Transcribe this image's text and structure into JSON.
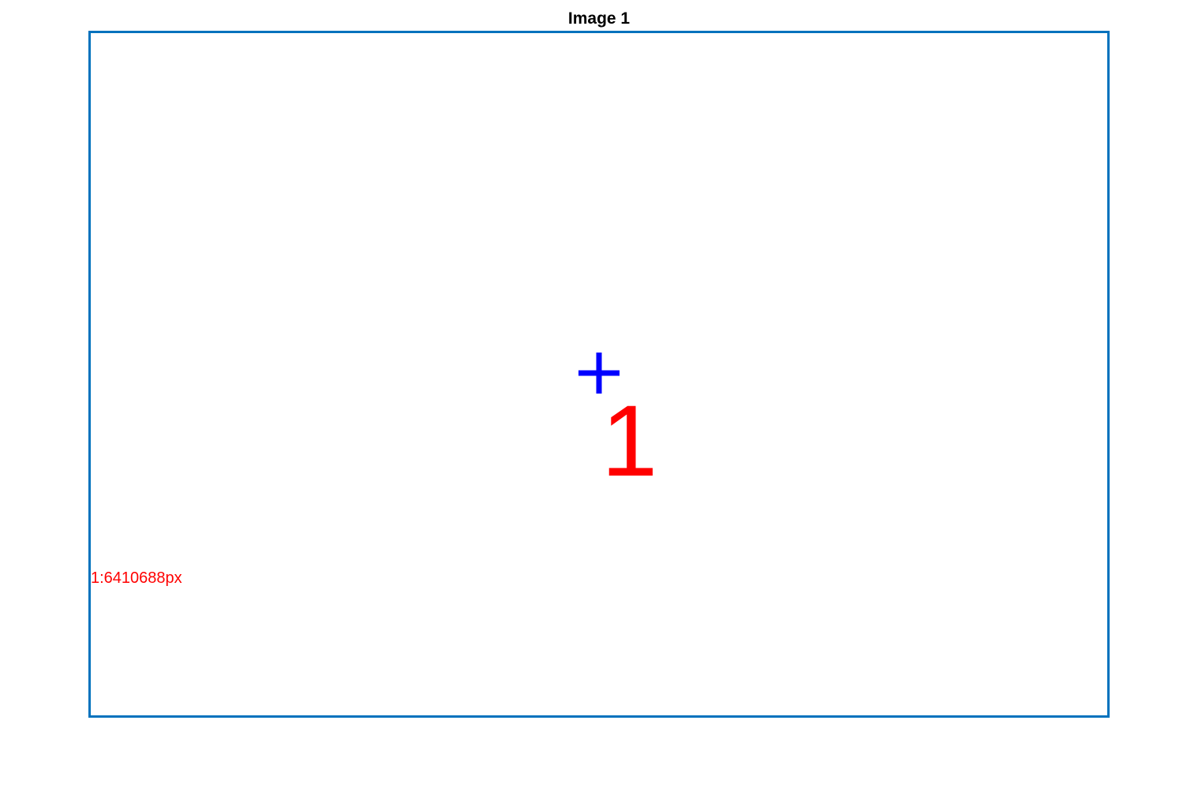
{
  "figure": {
    "title": "Image 1"
  },
  "regions": [
    {
      "label": "1",
      "area_text": "1:6410688px",
      "centroid_marker": "plus-icon"
    }
  ],
  "colors": {
    "frame": "#0072BD",
    "centroid_marker": "#0000FF",
    "region_label": "#FF0000",
    "area_label": "#FF0000",
    "title": "#000000",
    "background": "#FFFFFF"
  }
}
